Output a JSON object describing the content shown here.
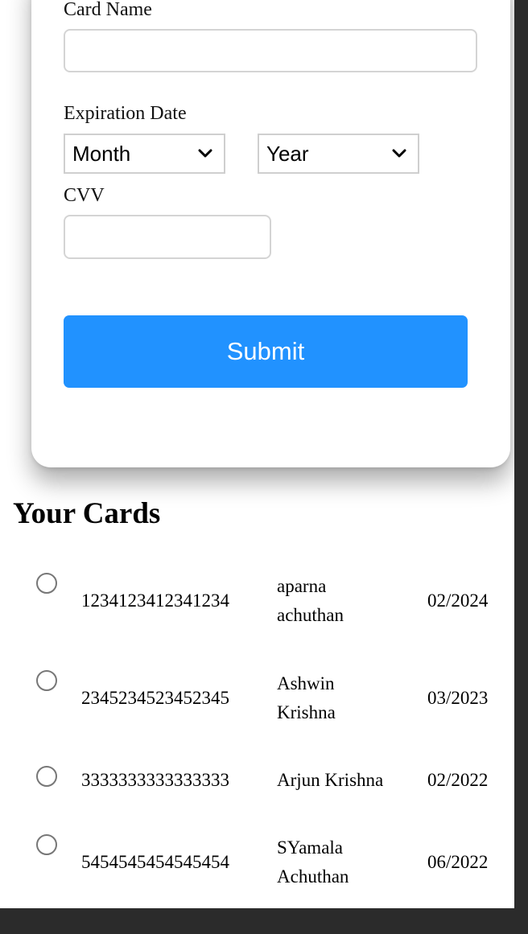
{
  "form": {
    "card_name_label": "Card Name",
    "card_name_value": "",
    "expiration_label": "Expiration Date",
    "month_selected": "Month",
    "year_selected": "Year",
    "cvv_label": "CVV",
    "cvv_value": "",
    "submit_label": "Submit"
  },
  "cards_section": {
    "title": "Your Cards",
    "cards": [
      {
        "number": "1234123412341234",
        "name_line1": "aparna",
        "name_line2": "achuthan",
        "expiry": "02/2024"
      },
      {
        "number": "2345234523452345",
        "name_line1": "Ashwin",
        "name_line2": "Krishna",
        "expiry": "03/2023"
      },
      {
        "number": "3333333333333333",
        "name_line1": "Arjun Krishna",
        "name_line2": "",
        "expiry": "02/2022"
      },
      {
        "number": "5454545454545454",
        "name_line1": "SYamala",
        "name_line2": "Achuthan",
        "expiry": "06/2022"
      }
    ]
  },
  "colors": {
    "submit_bg": "#2192ff",
    "outer_bg": "#2b2b2b"
  }
}
